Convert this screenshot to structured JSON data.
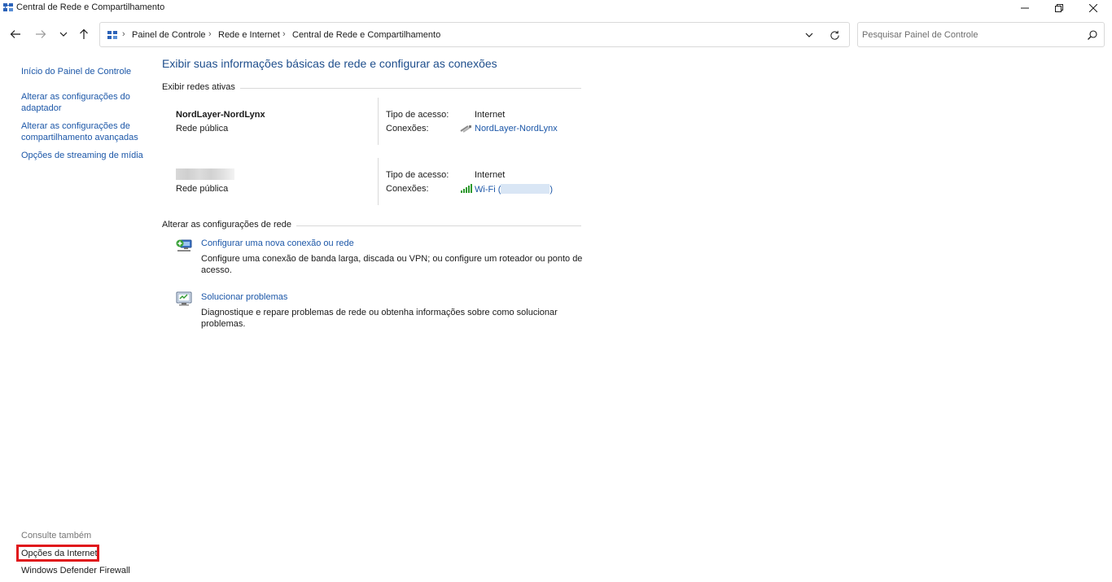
{
  "window": {
    "title": "Central de Rede e Compartilhamento",
    "app_icon": "control-panel-icon"
  },
  "addressbar": {
    "crumbs": [
      "Painel de Controle",
      "Rede e Internet",
      "Central de Rede e Compartilhamento"
    ],
    "separator": "›"
  },
  "search": {
    "placeholder": "Pesquisar Painel de Controle",
    "value": ""
  },
  "sidebar": {
    "links": [
      "Início do Painel de Controle",
      "Alterar as configurações do adaptador",
      "Alterar as configurações de compartilhamento avançadas",
      "Opções de streaming de mídia"
    ],
    "see_also_label": "Consulte também",
    "see_also_links": [
      "Opções da Internet",
      "Windows Defender Firewall"
    ],
    "highlight_color": "#e0161b"
  },
  "main": {
    "title": "Exibir suas informações básicas de rede e configurar as conexões",
    "active_networks_label": "Exibir redes ativas",
    "networks": [
      {
        "name": "NordLayer-NordLynx",
        "category": "Rede pública",
        "access_label": "Tipo de acesso:",
        "access_value": "Internet",
        "connections_label": "Conexões:",
        "connection": "NordLayer-NordLynx",
        "connection_icon": "vpn-cable-icon"
      },
      {
        "name": "",
        "category": "Rede pública",
        "access_label": "Tipo de acesso:",
        "access_value": "Internet",
        "connections_label": "Conexões:",
        "connection_prefix": "Wi-Fi (",
        "connection_suffix": ")",
        "connection_icon": "wifi-signal-icon"
      }
    ],
    "change_settings_label": "Alterar as configurações de rede",
    "tasks": [
      {
        "link": "Configurar uma nova conexão ou rede",
        "description": "Configure uma conexão de banda larga, discada ou VPN; ou configure um roteador ou ponto de acesso.",
        "icon": "new-connection-icon"
      },
      {
        "link": "Solucionar problemas",
        "description": "Diagnostique e repare problemas de rede ou obtenha informações sobre como solucionar problemas.",
        "icon": "troubleshoot-icon"
      }
    ]
  },
  "colors": {
    "link": "#1c57a8",
    "title": "#1e4e8c"
  }
}
